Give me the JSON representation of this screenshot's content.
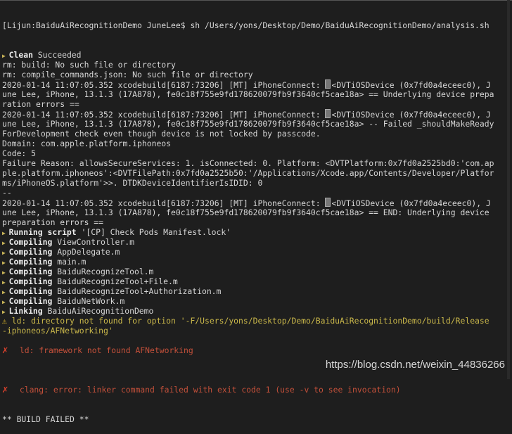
{
  "terminal": {
    "prompt": "Lijun:BaiduAiRecognitionDemo JuneLee$ sh /Users/yons/Desktop/Demo/BaiduAiRecognitionDemo/analysis.sh",
    "lines": [
      {
        "kind": "step",
        "bold": "Clean",
        "text": " Succeeded"
      },
      {
        "kind": "plain",
        "text": "rm: build: No such file or directory"
      },
      {
        "kind": "plain",
        "text": "rm: compile_commands.json: No such file or directory"
      },
      {
        "kind": "phone",
        "pre": "2020-01-14 11:07:05.352 xcodebuild[6187:73206] [MT] iPhoneConnect: ",
        "text": "<DVTiOSDevice (0x7fd0a4eceec0), J"
      },
      {
        "kind": "plain",
        "text": "une Lee, iPhone, 13.1.3 (17A878), fe0c18f755e9fd178620079fb9f3640cf5cae18a> == Underlying device prepa"
      },
      {
        "kind": "plain",
        "text": "ration errors =="
      },
      {
        "kind": "phone",
        "pre": "2020-01-14 11:07:05.352 xcodebuild[6187:73206] [MT] iPhoneConnect: ",
        "text": "<DVTiOSDevice (0x7fd0a4eceec0), J"
      },
      {
        "kind": "plain",
        "text": "une Lee, iPhone, 13.1.3 (17A878), fe0c18f755e9fd178620079fb9f3640cf5cae18a> -- Failed _shouldMakeReady"
      },
      {
        "kind": "plain",
        "text": "ForDevelopment check even though device is not locked by passcode."
      },
      {
        "kind": "plain",
        "text": "Domain: com.apple.platform.iphoneos"
      },
      {
        "kind": "plain",
        "text": "Code: 5"
      },
      {
        "kind": "plain",
        "text": "Failure Reason: allowsSecureServices: 1. isConnected: 0. Platform: <DVTPlatform:0x7fd0a2525bd0:'com.ap"
      },
      {
        "kind": "plain",
        "text": "ple.platform.iphoneos':<DVTFilePath:0x7fd0a2525b50:'/Applications/Xcode.app/Contents/Developer/Platfor"
      },
      {
        "kind": "plain",
        "text": "ms/iPhoneOS.platform'>>. DTDKDeviceIdentifierIsIDID: 0"
      },
      {
        "kind": "plain",
        "text": "--"
      },
      {
        "kind": "phone",
        "pre": "2020-01-14 11:07:05.352 xcodebuild[6187:73206] [MT] iPhoneConnect: ",
        "text": "<DVTiOSDevice (0x7fd0a4eceec0), J"
      },
      {
        "kind": "plain",
        "text": "une Lee, iPhone, 13.1.3 (17A878), fe0c18f755e9fd178620079fb9f3640cf5cae18a> == END: Underlying device"
      },
      {
        "kind": "plain",
        "text": "preparation errors =="
      },
      {
        "kind": "step",
        "bold": "Running script",
        "text": " '[CP] Check Pods Manifest.lock'"
      },
      {
        "kind": "step",
        "bold": "Compiling",
        "text": " ViewController.m"
      },
      {
        "kind": "step",
        "bold": "Compiling",
        "text": " AppDelegate.m"
      },
      {
        "kind": "step",
        "bold": "Compiling",
        "text": " main.m"
      },
      {
        "kind": "step",
        "bold": "Compiling",
        "text": " BaiduRecognizeTool.m"
      },
      {
        "kind": "step",
        "bold": "Compiling",
        "text": " BaiduRecognizeTool+File.m"
      },
      {
        "kind": "step",
        "bold": "Compiling",
        "text": " BaiduRecognizeTool+Authorization.m"
      },
      {
        "kind": "step",
        "bold": "Compiling",
        "text": " BaiduNetWork.m"
      },
      {
        "kind": "step",
        "bold": "Linking",
        "text": " BaiduAiRecognitionDemo"
      },
      {
        "kind": "warning",
        "text": " ld: directory not found for option '-F/Users/yons/Desktop/Demo/BaiduAiRecognitionDemo/build/Release"
      },
      {
        "kind": "warncont",
        "text": "-iphoneos/AFNetworking'"
      },
      {
        "kind": "blank",
        "text": ""
      },
      {
        "kind": "error",
        "text": "ld: framework not found AFNetworking"
      },
      {
        "kind": "blank",
        "text": ""
      },
      {
        "kind": "blank",
        "text": ""
      },
      {
        "kind": "blank",
        "text": ""
      },
      {
        "kind": "error",
        "text": "clang: error: linker command failed with exit code 1 (use -v to see invocation)"
      },
      {
        "kind": "blank",
        "text": ""
      },
      {
        "kind": "blank",
        "text": ""
      },
      {
        "kind": "plain",
        "text": "** BUILD FAILED **"
      }
    ]
  },
  "icons": {
    "step": "triangle-right-icon",
    "warning": "warning-icon",
    "error": "x-mark-icon",
    "device": "iphone-icon"
  },
  "colors": {
    "background": "#1e1e1e",
    "text": "#d6d6d6",
    "warning": "#c9b74a",
    "error": "#c4503a"
  },
  "watermark": "https://blog.csdn.net/weixin_44836266"
}
